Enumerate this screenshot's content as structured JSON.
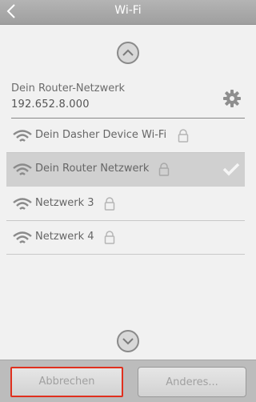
{
  "header": {
    "title": "Wi-Fi"
  },
  "router": {
    "name": "Dein Router-Netzwerk",
    "ip": "192.652.8.000"
  },
  "networks": [
    {
      "label": "Dein Dasher Device Wi-Fi",
      "locked": true,
      "selected": false
    },
    {
      "label": "Dein Router Netzwerk",
      "locked": true,
      "selected": true
    },
    {
      "label": "Netzwerk 3",
      "locked": true,
      "selected": false
    },
    {
      "label": "Netzwerk 4",
      "locked": true,
      "selected": false
    }
  ],
  "footer": {
    "cancel_label": "Abbrechen",
    "other_label": "Anderes..."
  },
  "colors": {
    "highlight_border": "#e0301e",
    "selected_row": "#d0d0d0",
    "titlebar": "#a8a8a8"
  },
  "icons": [
    "back-icon",
    "chevron-up-icon",
    "gear-icon",
    "wifi-icon",
    "lock-icon",
    "checkmark-icon",
    "chevron-down-icon"
  ]
}
